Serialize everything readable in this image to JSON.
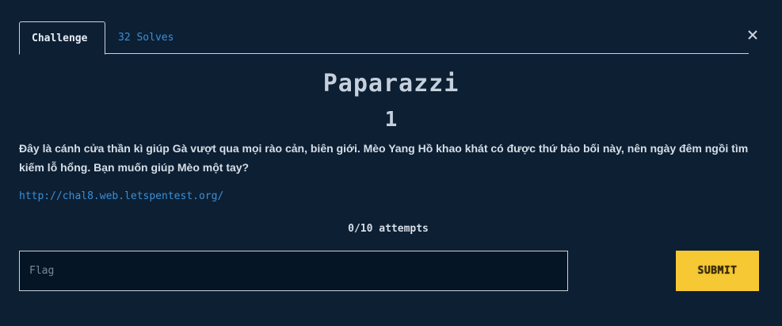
{
  "tabs": {
    "challenge_label": "Challenge",
    "solves_label": "32 Solves"
  },
  "challenge": {
    "name": "Paparazzi",
    "value": "1",
    "description": "Đây là cánh cửa thần kì giúp Gà vượt qua mọi rào cản, biên giới. Mèo Yang Hồ khao khát có được thứ bảo bối này, nên ngày đêm ngồi tìm kiếm lỗ hổng. Bạn muốn giúp Mèo một tay?",
    "link": "http://chal8.web.letspentest.org/",
    "attempts": "0/10 attempts"
  },
  "form": {
    "flag_placeholder": "Flag",
    "flag_value": "",
    "submit_label": "SUBMIT"
  },
  "icons": {
    "close": "close-icon"
  },
  "colors": {
    "background": "#0d1f33",
    "link": "#3b8fd6",
    "submit": "#f5c834"
  }
}
